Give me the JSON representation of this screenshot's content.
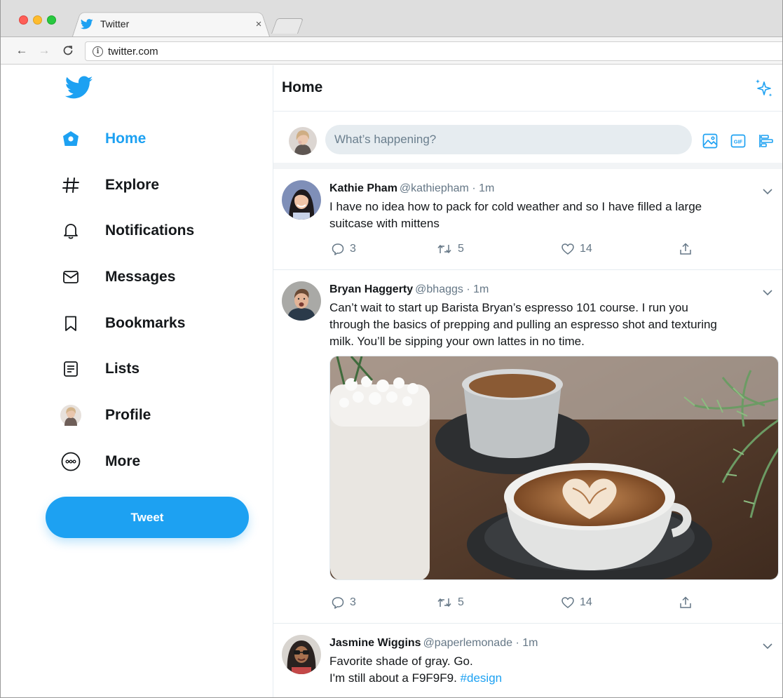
{
  "browser": {
    "tab_title": "Twitter",
    "tab_close": "×",
    "url": "twitter.com",
    "info_icon": "i",
    "back_icon": "←",
    "forward_icon": "→",
    "reload_icon": "C"
  },
  "nav": {
    "items": [
      {
        "label": "Home",
        "icon": "home-icon",
        "active": true
      },
      {
        "label": "Explore",
        "icon": "hashtag-icon"
      },
      {
        "label": "Notifications",
        "icon": "bell-icon"
      },
      {
        "label": "Messages",
        "icon": "envelope-icon"
      },
      {
        "label": "Bookmarks",
        "icon": "bookmark-icon"
      },
      {
        "label": "Lists",
        "icon": "list-icon"
      },
      {
        "label": "Profile",
        "icon": "avatar"
      },
      {
        "label": "More",
        "icon": "more-icon"
      }
    ],
    "tweet_button": "Tweet"
  },
  "main": {
    "title": "Home",
    "composer": {
      "placeholder": "What’s happening?"
    }
  },
  "tweets": [
    {
      "name": "Kathie Pham",
      "handle": "@kathiepham · 1m",
      "lines": [
        "I have no idea how to pack for cold weather and so I have filled a large",
        "suitcase with mittens"
      ],
      "replies": "3",
      "retweets": "5",
      "likes": "14"
    },
    {
      "name": "Bryan Haggerty",
      "handle": "@bhaggs · 1m",
      "lines": [
        "Can’t wait to start up Barista Bryan’s espresso 101 course. I run you",
        "through the basics of prepping and pulling an espresso shot and texturing",
        "milk. You’ll be sipping your own lattes in no time."
      ],
      "replies": "3",
      "retweets": "5",
      "likes": "14"
    },
    {
      "name": "Jasmine Wiggins",
      "handle": "@paperlemonade · 1m",
      "lines": [
        "Favorite shade of gray. Go.",
        "I'm still about a F9F9F9. "
      ],
      "hashtag": "#design"
    }
  ],
  "colors": {
    "accent": "#1da1f2",
    "text": "#14171a",
    "muted": "#657786",
    "divider": "#e6ecf0"
  }
}
